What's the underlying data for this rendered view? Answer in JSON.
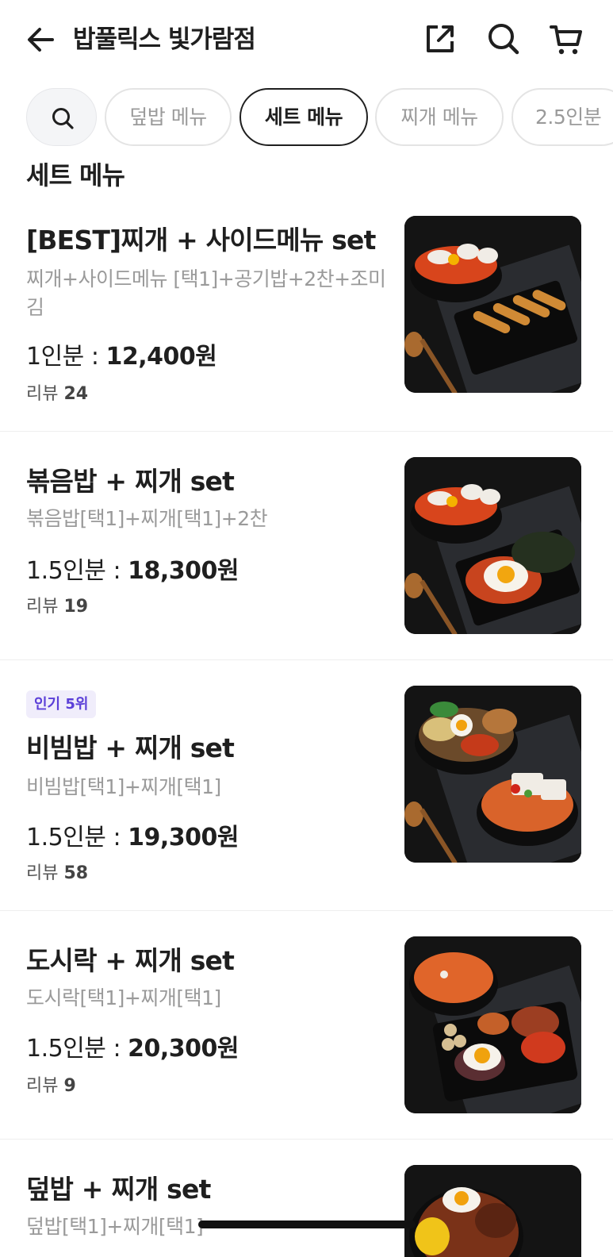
{
  "header": {
    "title": "밥풀릭스 빛가람점",
    "icons": [
      "back-arrow-icon",
      "share-icon",
      "search-icon",
      "cart-icon"
    ]
  },
  "chips": [
    {
      "label": "덮밥 메뉴",
      "active": false
    },
    {
      "label": "세트 메뉴",
      "active": true
    },
    {
      "label": "찌개 메뉴",
      "active": false
    },
    {
      "label": "2.5인분",
      "active": false
    }
  ],
  "section_title": "세트 메뉴",
  "items": [
    {
      "badge": "",
      "name": "[BEST]찌개 + 사이드메뉴 set",
      "desc": "찌개+사이드메뉴 [택1]+공기밥+2찬+조미김",
      "price_prefix": "1인분 : ",
      "price": "12,400원",
      "review_label": "리뷰 ",
      "review_count": "24"
    },
    {
      "badge": "",
      "name": "볶음밥 + 찌개 set",
      "desc": "볶음밥[택1]+찌개[택1]+2찬",
      "price_prefix": "1.5인분 : ",
      "price": "18,300원",
      "review_label": "리뷰 ",
      "review_count": "19"
    },
    {
      "badge": "인기 5위",
      "name": "비빔밥 + 찌개 set",
      "desc": "비빔밥[택1]+찌개[택1]",
      "price_prefix": "1.5인분 : ",
      "price": "19,300원",
      "review_label": "리뷰 ",
      "review_count": "58"
    },
    {
      "badge": "",
      "name": "도시락 + 찌개 set",
      "desc": "도시락[택1]+찌개[택1]",
      "price_prefix": "1.5인분 : ",
      "price": "20,300원",
      "review_label": "리뷰 ",
      "review_count": "9"
    },
    {
      "badge": "",
      "name": "덮밥 + 찌개 set",
      "desc": "덮밥[택1]+찌개[택1]",
      "price_prefix": "",
      "price": "",
      "review_label": "",
      "review_count": ""
    }
  ],
  "colors": {
    "text": "#1f1f1f",
    "muted": "#9a9a9a",
    "badge_bg": "#f0edfb",
    "badge_text": "#5b3fd8"
  }
}
